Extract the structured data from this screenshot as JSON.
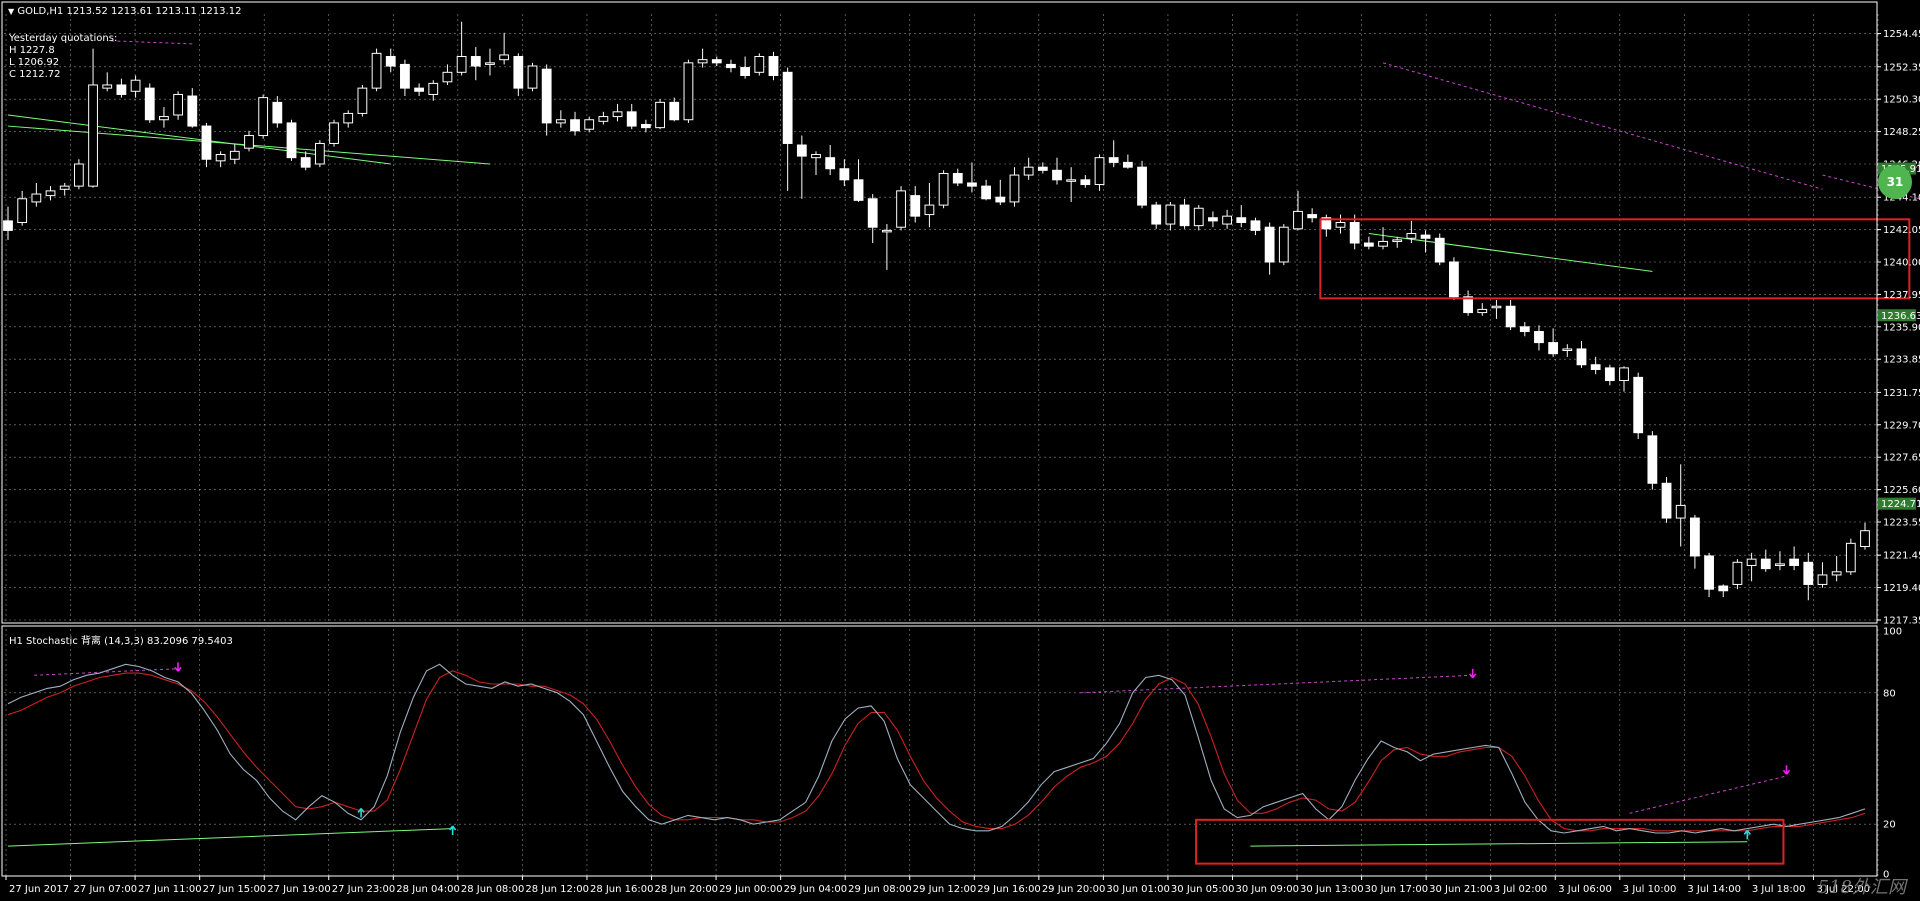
{
  "header": {
    "symbol_label": "GOLD,H1",
    "ohlc": "1213.52 1213.61 1213.11 1213.12"
  },
  "quotes": {
    "title": "Yesterday quotations:",
    "high": "H 1227.8",
    "low": "L 1206.92",
    "close": "C 1212.72"
  },
  "indicator": {
    "label": "H1 Stochastic 背离 (14,3,3) 83.2096 79.5403"
  },
  "badges": {
    "right_circle": "31"
  },
  "watermark": "518外汇网",
  "colors": {
    "background": "#000000",
    "grid": "#ffffff",
    "candle": "#ffffff",
    "trendline": "#7cfc7c",
    "divergence": "#cc44cc",
    "stoch_main": "#9fb0c0",
    "stoch_signal": "#cc2222",
    "highlight_box": "#dd2222",
    "up_arrow": "#22dddd",
    "down_arrow": "#ee22ee"
  },
  "chart_data": [
    {
      "type": "candlestick",
      "title": "GOLD,H1",
      "price_levels": [
        "1254.45",
        "1252.35",
        "1250.30",
        "1248.25",
        "1246.20",
        "1244.10",
        "1242.05",
        "1240.00",
        "1237.95",
        "1235.90",
        "1233.85",
        "1231.75",
        "1229.70",
        "1227.65",
        "1225.60",
        "1223.55",
        "1221.45",
        "1219.40",
        "1217.35"
      ],
      "current_price_tags": [
        "1245.91",
        "1236.63",
        "1224.71"
      ],
      "time_labels": [
        "27 Jun 2017",
        "27 Jun 07:00",
        "27 Jun 11:00",
        "27 Jun 15:00",
        "27 Jun 19:00",
        "27 Jun 23:00",
        "28 Jun 04:00",
        "28 Jun 08:00",
        "28 Jun 12:00",
        "28 Jun 16:00",
        "28 Jun 20:00",
        "29 Jun 00:00",
        "29 Jun 04:00",
        "29 Jun 08:00",
        "29 Jun 12:00",
        "29 Jun 16:00",
        "29 Jun 20:00",
        "30 Jun 01:00",
        "30 Jun 05:00",
        "30 Jun 09:00",
        "30 Jun 13:00",
        "30 Jun 17:00",
        "30 Jun 21:00",
        "3 Jul 02:00",
        "3 Jul 06:00",
        "3 Jul 10:00",
        "3 Jul 14:00",
        "3 Jul 18:00",
        "3 Jul 22:00"
      ],
      "ylim": [
        1217.35,
        1255.5
      ],
      "candles": [
        [
          1242.6,
          1243.5,
          1241.4,
          1242.0
        ],
        [
          1242.5,
          1244.5,
          1242.3,
          1244.0
        ],
        [
          1243.8,
          1245.0,
          1243.5,
          1244.3
        ],
        [
          1244.2,
          1244.8,
          1243.9,
          1244.5
        ],
        [
          1244.6,
          1245.0,
          1244.2,
          1244.8
        ],
        [
          1244.8,
          1246.5,
          1244.6,
          1246.2
        ],
        [
          1244.8,
          1253.5,
          1244.7,
          1251.2
        ],
        [
          1251.0,
          1252.0,
          1250.8,
          1251.2
        ],
        [
          1251.2,
          1251.6,
          1250.4,
          1250.6
        ],
        [
          1250.8,
          1251.8,
          1250.4,
          1251.5
        ],
        [
          1251.0,
          1251.3,
          1248.8,
          1249.0
        ],
        [
          1249.0,
          1249.8,
          1248.5,
          1249.2
        ],
        [
          1249.3,
          1250.8,
          1249.0,
          1250.6
        ],
        [
          1250.5,
          1251.0,
          1248.5,
          1248.6
        ],
        [
          1248.6,
          1248.8,
          1246.0,
          1246.5
        ],
        [
          1246.4,
          1247.0,
          1246.0,
          1246.8
        ],
        [
          1246.5,
          1247.5,
          1246.2,
          1247.0
        ],
        [
          1247.2,
          1248.3,
          1247.0,
          1248.0
        ],
        [
          1248.0,
          1250.6,
          1247.8,
          1250.4
        ],
        [
          1250.1,
          1250.5,
          1248.5,
          1248.8
        ],
        [
          1248.8,
          1249.0,
          1246.4,
          1246.6
        ],
        [
          1246.6,
          1247.0,
          1245.8,
          1246.0
        ],
        [
          1246.2,
          1247.7,
          1246.0,
          1247.5
        ],
        [
          1247.5,
          1249.0,
          1247.3,
          1248.8
        ],
        [
          1248.8,
          1249.6,
          1248.5,
          1249.4
        ],
        [
          1249.4,
          1251.2,
          1249.2,
          1251.0
        ],
        [
          1251.0,
          1253.5,
          1250.8,
          1253.2
        ],
        [
          1253.0,
          1253.5,
          1252.0,
          1252.4
        ],
        [
          1252.5,
          1252.8,
          1250.5,
          1251.0
        ],
        [
          1251.0,
          1251.3,
          1250.5,
          1250.8
        ],
        [
          1250.6,
          1251.5,
          1250.2,
          1251.3
        ],
        [
          1251.4,
          1252.5,
          1251.2,
          1252.0
        ],
        [
          1252.0,
          1255.2,
          1251.8,
          1253.0
        ],
        [
          1253.0,
          1253.6,
          1251.5,
          1252.4
        ],
        [
          1252.5,
          1253.5,
          1251.8,
          1252.6
        ],
        [
          1252.8,
          1254.5,
          1252.5,
          1253.1
        ],
        [
          1253.0,
          1253.2,
          1250.5,
          1251.0
        ],
        [
          1251.0,
          1252.6,
          1250.8,
          1252.4
        ],
        [
          1252.2,
          1252.5,
          1248.0,
          1248.8
        ],
        [
          1248.8,
          1249.6,
          1248.5,
          1249.0
        ],
        [
          1249.0,
          1249.5,
          1248.0,
          1248.3
        ],
        [
          1248.4,
          1249.2,
          1248.2,
          1249.0
        ],
        [
          1248.9,
          1249.5,
          1248.7,
          1249.2
        ],
        [
          1249.2,
          1250.0,
          1248.9,
          1249.5
        ],
        [
          1249.5,
          1250.0,
          1248.4,
          1248.6
        ],
        [
          1248.7,
          1249.0,
          1248.2,
          1248.5
        ],
        [
          1248.5,
          1250.3,
          1248.4,
          1250.1
        ],
        [
          1250.1,
          1250.4,
          1248.9,
          1249.0
        ],
        [
          1249.0,
          1252.8,
          1248.8,
          1252.6
        ],
        [
          1252.6,
          1253.5,
          1252.3,
          1252.8
        ],
        [
          1252.8,
          1253.0,
          1252.4,
          1252.6
        ],
        [
          1252.5,
          1252.8,
          1252.0,
          1252.3
        ],
        [
          1252.3,
          1253.0,
          1251.6,
          1251.8
        ],
        [
          1252.0,
          1253.2,
          1251.8,
          1253.0
        ],
        [
          1253.0,
          1253.3,
          1251.5,
          1251.8
        ],
        [
          1252.0,
          1252.3,
          1244.5,
          1247.5
        ],
        [
          1247.4,
          1248.0,
          1244.0,
          1246.7
        ],
        [
          1246.6,
          1247.0,
          1245.5,
          1246.8
        ],
        [
          1246.6,
          1247.4,
          1245.5,
          1245.9
        ],
        [
          1245.9,
          1246.5,
          1244.8,
          1245.2
        ],
        [
          1245.2,
          1246.5,
          1243.8,
          1243.9
        ],
        [
          1244.0,
          1244.3,
          1241.2,
          1242.2
        ],
        [
          1242.0,
          1242.4,
          1239.5,
          1242.0
        ],
        [
          1242.2,
          1244.8,
          1242.0,
          1244.5
        ],
        [
          1244.2,
          1244.8,
          1242.5,
          1242.9
        ],
        [
          1243.0,
          1245.0,
          1242.2,
          1243.6
        ],
        [
          1243.6,
          1245.8,
          1243.4,
          1245.6
        ],
        [
          1245.6,
          1245.9,
          1244.8,
          1245.0
        ],
        [
          1245.0,
          1246.3,
          1244.4,
          1244.8
        ],
        [
          1244.8,
          1245.2,
          1243.9,
          1244.0
        ],
        [
          1244.1,
          1245.2,
          1243.6,
          1243.8
        ],
        [
          1243.8,
          1246.0,
          1243.5,
          1245.5
        ],
        [
          1245.5,
          1246.6,
          1245.2,
          1246.0
        ],
        [
          1246.0,
          1246.3,
          1245.6,
          1245.8
        ],
        [
          1245.8,
          1246.6,
          1244.9,
          1245.2
        ],
        [
          1245.2,
          1246.0,
          1243.8,
          1245.2
        ],
        [
          1245.2,
          1245.5,
          1244.7,
          1244.9
        ],
        [
          1244.9,
          1246.8,
          1244.5,
          1246.6
        ],
        [
          1246.6,
          1247.7,
          1246.0,
          1246.3
        ],
        [
          1246.3,
          1246.8,
          1245.9,
          1246.0
        ],
        [
          1246.0,
          1246.4,
          1243.4,
          1243.6
        ],
        [
          1243.6,
          1243.8,
          1242.1,
          1242.4
        ],
        [
          1242.4,
          1243.8,
          1242.0,
          1243.6
        ],
        [
          1243.6,
          1244.0,
          1242.1,
          1242.3
        ],
        [
          1242.3,
          1243.6,
          1242.0,
          1243.4
        ],
        [
          1242.8,
          1243.2,
          1242.2,
          1242.6
        ],
        [
          1242.4,
          1243.3,
          1242.1,
          1242.9
        ],
        [
          1242.8,
          1243.6,
          1242.2,
          1242.5
        ],
        [
          1242.6,
          1242.8,
          1241.7,
          1242.0
        ],
        [
          1242.2,
          1242.5,
          1239.2,
          1240.0
        ],
        [
          1240.0,
          1242.4,
          1239.8,
          1242.2
        ],
        [
          1242.1,
          1244.5,
          1242.0,
          1243.2
        ],
        [
          1243.0,
          1243.4,
          1242.5,
          1242.8
        ],
        [
          1242.8,
          1243.0,
          1241.6,
          1242.1
        ],
        [
          1242.2,
          1243.0,
          1241.8,
          1242.5
        ],
        [
          1242.5,
          1243.0,
          1240.8,
          1241.2
        ],
        [
          1241.2,
          1241.6,
          1240.8,
          1241.0
        ],
        [
          1241.0,
          1242.2,
          1240.8,
          1241.3
        ],
        [
          1241.3,
          1241.6,
          1240.9,
          1241.4
        ],
        [
          1241.5,
          1242.6,
          1241.2,
          1241.8
        ],
        [
          1241.7,
          1242.0,
          1240.6,
          1241.5
        ],
        [
          1241.5,
          1241.8,
          1239.8,
          1240.0
        ],
        [
          1240.0,
          1240.3,
          1237.6,
          1237.8
        ],
        [
          1237.8,
          1238.2,
          1236.6,
          1236.8
        ],
        [
          1236.8,
          1237.4,
          1236.6,
          1237.0
        ],
        [
          1237.2,
          1237.6,
          1236.4,
          1237.2
        ],
        [
          1237.2,
          1237.6,
          1235.7,
          1235.9
        ],
        [
          1235.9,
          1236.2,
          1235.3,
          1235.6
        ],
        [
          1235.6,
          1236.0,
          1234.4,
          1234.9
        ],
        [
          1234.9,
          1235.8,
          1234.0,
          1234.2
        ],
        [
          1234.4,
          1234.8,
          1234.0,
          1234.5
        ],
        [
          1234.5,
          1235.0,
          1233.3,
          1233.5
        ],
        [
          1233.5,
          1234.0,
          1232.9,
          1233.2
        ],
        [
          1233.3,
          1233.5,
          1232.2,
          1232.5
        ],
        [
          1232.5,
          1233.4,
          1231.8,
          1233.3
        ],
        [
          1232.7,
          1233.0,
          1228.8,
          1229.2
        ],
        [
          1229.0,
          1229.3,
          1225.6,
          1226.0
        ],
        [
          1226.0,
          1226.4,
          1223.5,
          1223.8
        ],
        [
          1223.8,
          1227.2,
          1222.0,
          1224.6
        ],
        [
          1223.8,
          1224.0,
          1220.6,
          1221.4
        ],
        [
          1221.4,
          1221.6,
          1218.8,
          1219.3
        ],
        [
          1219.5,
          1219.6,
          1218.8,
          1219.2
        ],
        [
          1219.6,
          1221.2,
          1219.3,
          1221.0
        ],
        [
          1220.8,
          1221.6,
          1219.8,
          1221.2
        ],
        [
          1221.2,
          1221.8,
          1220.4,
          1220.6
        ],
        [
          1220.8,
          1221.7,
          1220.5,
          1220.9
        ],
        [
          1221.2,
          1222.0,
          1220.5,
          1220.8
        ],
        [
          1221.0,
          1221.6,
          1218.6,
          1219.6
        ],
        [
          1219.6,
          1221.0,
          1219.4,
          1220.2
        ],
        [
          1220.2,
          1221.4,
          1219.8,
          1220.4
        ],
        [
          1220.4,
          1222.5,
          1220.2,
          1222.2
        ],
        [
          1222.0,
          1223.5,
          1221.8,
          1223.0
        ]
      ]
    },
    {
      "type": "line",
      "title": "H1 Stochastic 背离 (14,3,3) 83.2096 79.5403",
      "levels": [
        "100",
        "80",
        "20",
        "0"
      ],
      "ylim": [
        0,
        100
      ],
      "series": [
        {
          "values": [
            75,
            78,
            80,
            82,
            83,
            86,
            88,
            89,
            91,
            93,
            92,
            90,
            87,
            85,
            80,
            72,
            63,
            52,
            45,
            40,
            32,
            26,
            22,
            28,
            33,
            30,
            25,
            22,
            28,
            42,
            62,
            78,
            90,
            93,
            88,
            84,
            83,
            82,
            85,
            83,
            84,
            82,
            80,
            76,
            70,
            58,
            46,
            35,
            28,
            22,
            20,
            22,
            24,
            23,
            22,
            23,
            22,
            20,
            21,
            22,
            26,
            30,
            42,
            58,
            68,
            73,
            74,
            67,
            50,
            38,
            32,
            26,
            20,
            18,
            17,
            17,
            19,
            24,
            30,
            38,
            44,
            46,
            48,
            50,
            57,
            66,
            80,
            87,
            88,
            86,
            79,
            60,
            40,
            27,
            23,
            24,
            28,
            30,
            32,
            34,
            27,
            22,
            28,
            40,
            50,
            58,
            55,
            53,
            49,
            52,
            53,
            54,
            55,
            56,
            55,
            43,
            30,
            22,
            17,
            16,
            17,
            18,
            19,
            17,
            18,
            17,
            16,
            16,
            17,
            16,
            17,
            18,
            17,
            18,
            19,
            20,
            19,
            20,
            21,
            22,
            23,
            25,
            27
          ]
        },
        {
          "values": [
            70,
            72,
            75,
            78,
            80,
            83,
            85,
            87,
            88,
            89,
            89,
            88,
            86,
            84,
            81,
            76,
            69,
            61,
            53,
            46,
            40,
            34,
            28,
            27,
            28,
            30,
            28,
            26,
            26,
            31,
            45,
            61,
            77,
            87,
            90,
            88,
            85,
            84,
            84,
            84,
            83,
            83,
            81,
            79,
            75,
            68,
            58,
            47,
            37,
            29,
            24,
            22,
            22,
            23,
            23,
            23,
            22,
            22,
            21,
            21,
            23,
            26,
            33,
            43,
            56,
            66,
            71,
            71,
            63,
            51,
            40,
            32,
            26,
            21,
            19,
            18,
            18,
            20,
            24,
            30,
            37,
            42,
            46,
            48,
            51,
            57,
            66,
            77,
            84,
            87,
            84,
            75,
            60,
            43,
            31,
            25,
            25,
            27,
            30,
            32,
            31,
            27,
            26,
            30,
            39,
            49,
            54,
            55,
            52,
            51,
            51,
            53,
            54,
            55,
            55,
            51,
            42,
            31,
            22,
            18,
            17,
            17,
            18,
            18,
            18,
            18,
            17,
            17,
            17,
            17,
            17,
            17,
            17,
            17,
            18,
            19,
            19,
            19,
            20,
            21,
            22,
            23,
            25
          ]
        }
      ]
    }
  ]
}
